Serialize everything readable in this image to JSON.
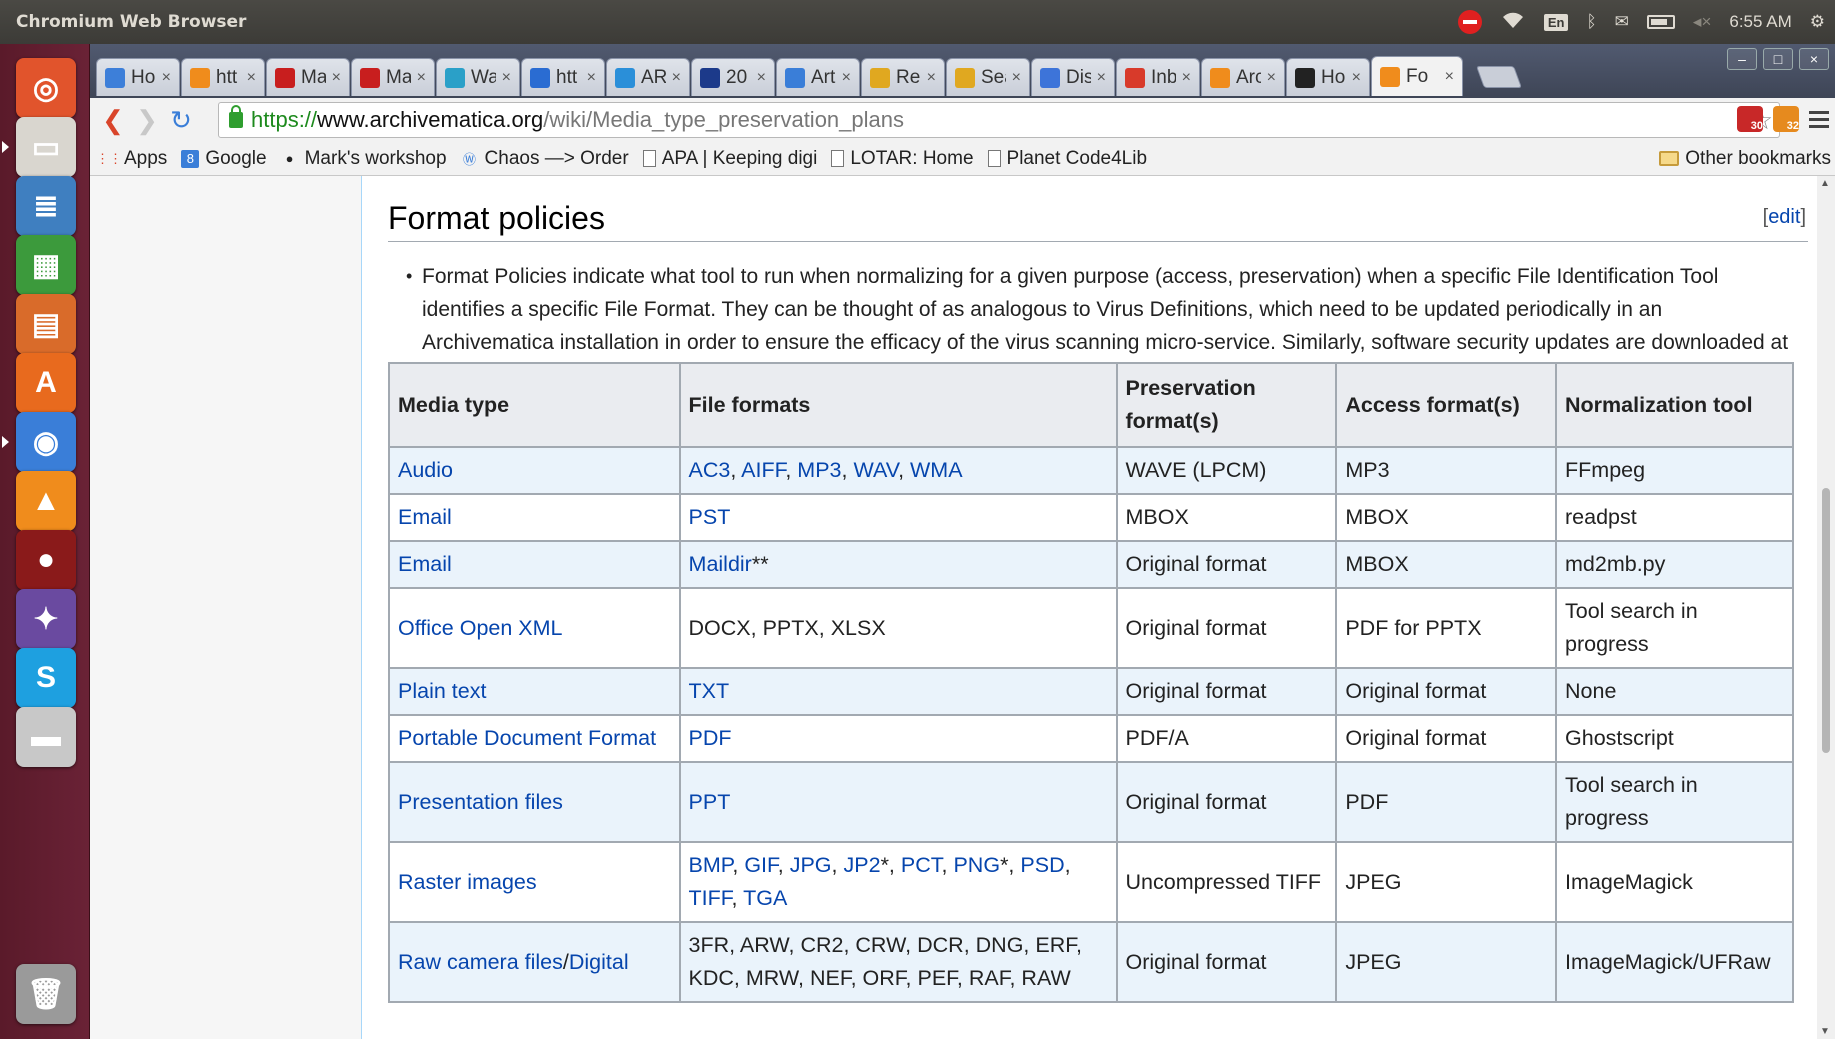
{
  "top_panel": {
    "app_title": "Chromium Web Browser",
    "input_lang": "En",
    "time": "6:55 AM"
  },
  "launcher": {
    "items": [
      "ubuntu-dash",
      "files",
      "libreoffice-writer",
      "libreoffice-calc",
      "libreoffice-impress",
      "software-center",
      "chromium",
      "vlc",
      "screen-recorder",
      "pidgin",
      "skype",
      "drive",
      "trash"
    ]
  },
  "tabs": [
    {
      "title": "Ho",
      "icon": "dropbox-icon",
      "color": "#3d7fd9"
    },
    {
      "title": "htt",
      "icon": "amazon-icon",
      "color": "#f08c1c"
    },
    {
      "title": "Ma",
      "icon": "acrobat-icon",
      "color": "#c81e1e"
    },
    {
      "title": "Ma",
      "icon": "acrobat-icon",
      "color": "#c81e1e"
    },
    {
      "title": "Wa",
      "icon": "cube-icon",
      "color": "#2aa0c8"
    },
    {
      "title": "htt",
      "icon": "r-icon",
      "color": "#2a6cd2"
    },
    {
      "title": "AR",
      "icon": "s-icon",
      "color": "#2a8fd9"
    },
    {
      "title": "20",
      "icon": "star-flag-icon",
      "color": "#1c3a8a"
    },
    {
      "title": "Art",
      "icon": "calendar-icon",
      "color": "#3a7ed8"
    },
    {
      "title": "Re",
      "icon": "drive-icon",
      "color": "#e0a820"
    },
    {
      "title": "Sea",
      "icon": "drive-icon",
      "color": "#e0a820"
    },
    {
      "title": "Dis",
      "icon": "docs-icon",
      "color": "#3d74d9"
    },
    {
      "title": "Inb",
      "icon": "gmail-icon",
      "color": "#d83a2a"
    },
    {
      "title": "Arc",
      "icon": "amazon-icon",
      "color": "#f08c1c"
    },
    {
      "title": "Ho",
      "icon": "github-icon",
      "color": "#222222"
    },
    {
      "title": "Fo",
      "icon": "archivematica-icon",
      "color": "#f08c1c",
      "active": true
    }
  ],
  "window_buttons": {
    "minimize": "–",
    "maximize": "□",
    "close": "×"
  },
  "toolbar": {
    "back": "❮",
    "forward": "❯",
    "reload": "↻",
    "url_scheme": "https://",
    "url_host": "www.archivematica.org",
    "url_path": "/wiki/Media_type_preservation_plans",
    "ext_badge_1": "30",
    "ext_badge_2": "32"
  },
  "bookmarks": [
    {
      "label": "Apps",
      "icon": "apps-grid-icon"
    },
    {
      "label": "Google",
      "icon": "google-icon"
    },
    {
      "label": "Mark's workshop",
      "icon": "github-icon"
    },
    {
      "label": "Chaos —> Order",
      "icon": "wordpress-icon"
    },
    {
      "label": "APA | Keeping digi",
      "icon": "page-icon"
    },
    {
      "label": "LOTAR: Home",
      "icon": "page-icon"
    },
    {
      "label": "Planet Code4Lib",
      "icon": "page-icon"
    }
  ],
  "other_bookmarks": "Other bookmarks",
  "content": {
    "section_title": "Format policies",
    "edit_open": "[",
    "edit_label": "edit",
    "edit_close": "]",
    "policy_text": "Format Policies indicate what tool to run when normalizing for a given purpose (access, preservation) when a specific File Identification Tool identifies a specific File Format. They can be thought of as analogous to Virus Definitions, which need to be updated periodically in an Archivematica installation in order to ensure the efficacy of the virus scanning micro-service. Similarly, software security updates are downloaded at the operating system level, to keep the host machine secure."
  },
  "table": {
    "headers": [
      "Media type",
      "File formats",
      "Preservation format(s)",
      "Access format(s)",
      "Normalization tool"
    ],
    "rows": [
      {
        "media": "Audio",
        "formats": [
          {
            "t": "AC3",
            "l": true
          },
          {
            "t": ", "
          },
          {
            "t": "AIFF",
            "l": true
          },
          {
            "t": ", "
          },
          {
            "t": "MP3",
            "l": true
          },
          {
            "t": ", "
          },
          {
            "t": "WAV",
            "l": true
          },
          {
            "t": ", "
          },
          {
            "t": "WMA",
            "l": true
          }
        ],
        "preservation": "WAVE (LPCM)",
        "access": "MP3",
        "tool": "FFmpeg"
      },
      {
        "media": "Email",
        "formats": [
          {
            "t": "PST",
            "l": true
          }
        ],
        "preservation": "MBOX",
        "access": "MBOX",
        "tool": "readpst"
      },
      {
        "media": "Email",
        "formats": [
          {
            "t": "Maildir",
            "l": true
          },
          {
            "t": "**"
          }
        ],
        "preservation": "Original format",
        "access": "MBOX",
        "tool": "md2mb.py"
      },
      {
        "media": "Office Open XML",
        "formats": [
          {
            "t": "DOCX, PPTX, XLSX"
          }
        ],
        "preservation": "Original format",
        "access": "PDF for PPTX",
        "tool": "Tool search in progress"
      },
      {
        "media": "Plain text",
        "formats": [
          {
            "t": "TXT",
            "l": true
          }
        ],
        "preservation": "Original format",
        "access": "Original format",
        "tool": "None"
      },
      {
        "media": "Portable Document Format",
        "formats": [
          {
            "t": "PDF",
            "l": true
          }
        ],
        "preservation": "PDF/A",
        "access": "Original format",
        "tool": "Ghostscript"
      },
      {
        "media": "Presentation files",
        "formats": [
          {
            "t": "PPT",
            "l": true
          }
        ],
        "preservation": "Original format",
        "access": "PDF",
        "tool": "Tool search in progress"
      },
      {
        "media": "Raster images",
        "formats": [
          {
            "t": "BMP",
            "l": true
          },
          {
            "t": ", "
          },
          {
            "t": "GIF",
            "l": true
          },
          {
            "t": ", "
          },
          {
            "t": "JPG",
            "l": true
          },
          {
            "t": ", "
          },
          {
            "t": "JP2",
            "l": true
          },
          {
            "t": "*, "
          },
          {
            "t": "PCT",
            "l": true
          },
          {
            "t": ", "
          },
          {
            "t": "PNG",
            "l": true
          },
          {
            "t": "*, "
          },
          {
            "t": "PSD",
            "l": true
          },
          {
            "t": ", "
          },
          {
            "t": "TIFF",
            "l": true
          },
          {
            "t": ", "
          },
          {
            "t": "TGA",
            "l": true
          }
        ],
        "preservation": "Uncompressed TIFF",
        "access": "JPEG",
        "tool": "ImageMagick"
      },
      {
        "media": "Raw camera files/Digital",
        "media_parts": [
          {
            "t": "Raw camera files",
            "l": true
          },
          {
            "t": "/"
          },
          {
            "t": "Digital",
            "l": true
          }
        ],
        "formats": [
          {
            "t": "3FR, ARW, CR2, CRW, DCR, DNG, ERF, KDC, MRW, NEF, ORF, PEF, RAF, RAW"
          }
        ],
        "preservation": "Original format",
        "access": "JPEG",
        "tool": "ImageMagick/UFRaw"
      }
    ]
  }
}
